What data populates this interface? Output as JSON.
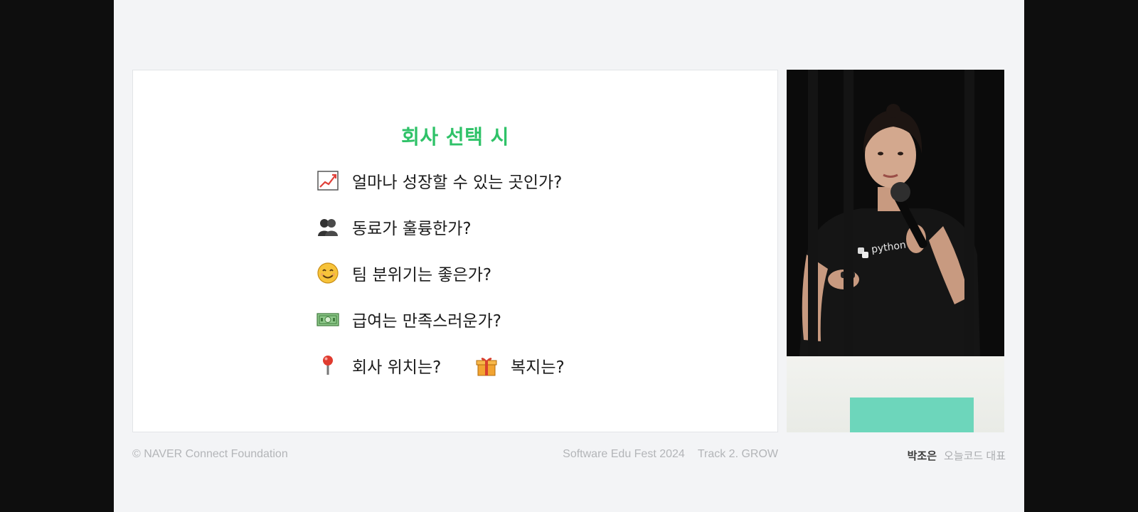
{
  "slide": {
    "title": "회사 선택 시",
    "items": [
      {
        "icon": "chart-increasing-icon",
        "text": "얼마나 성장할 수 있는 곳인가?"
      },
      {
        "icon": "people-icon",
        "text": "동료가 훌륭한가?"
      },
      {
        "icon": "smiling-face-icon",
        "text": "팀 분위기는 좋은가?"
      },
      {
        "icon": "money-bill-icon",
        "text": "급여는 만족스러운가?"
      }
    ],
    "last_row": [
      {
        "icon": "map-pin-icon",
        "text": "회사 위치는?"
      },
      {
        "icon": "gift-icon",
        "text": "복지는?"
      }
    ]
  },
  "video": {
    "shirt_text": "python"
  },
  "footer": {
    "copyright": "© NAVER Connect Foundation",
    "event": "Software Edu Fest 2024",
    "track": "Track 2. GROW",
    "speaker_name": "박조은",
    "speaker_role": "오늘코드 대표"
  },
  "colors": {
    "title_green": "#2fc268",
    "frame_bg": "#f3f4f6",
    "letterbox": "#0e0e0e",
    "mint_panel": "#6dd6bb"
  }
}
